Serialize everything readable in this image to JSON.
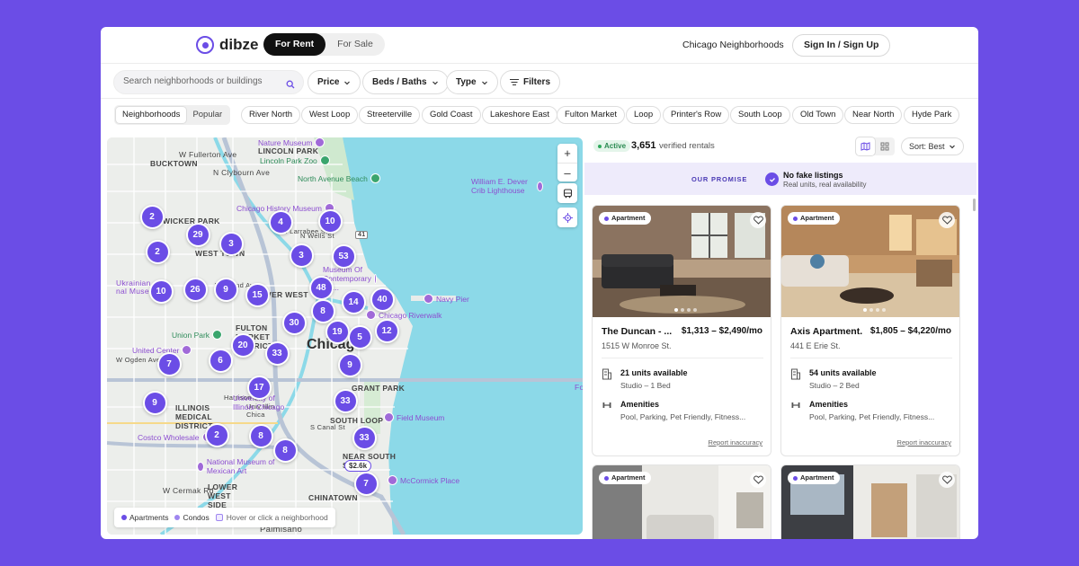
{
  "header": {
    "logo": "dibze",
    "seg": [
      {
        "label": "For Rent",
        "active": true
      },
      {
        "label": "For Sale",
        "active": false
      }
    ],
    "link": "Chicago Neighborhoods",
    "signin": "Sign In / Sign Up"
  },
  "filters": {
    "search_placeholder": "Search neighborhoods or buildings",
    "price": "Price",
    "beds": "Beds / Baths",
    "type": "Type",
    "more": "Filters"
  },
  "chips": {
    "tabs": [
      "Neighborhoods",
      "Popular"
    ],
    "items": [
      "River North",
      "West Loop",
      "Streeterville",
      "Gold Coast",
      "Lakeshore East",
      "Fulton Market",
      "Loop",
      "Printer's Row",
      "South Loop",
      "Old Town",
      "Near North",
      "Hyde Park"
    ]
  },
  "map": {
    "city": "Chicago",
    "labels": [
      "BUCKTOWN",
      "W Fullerton Ave",
      "N Clybourn Ave",
      "LINCOLN PARK",
      "WICKER PARK",
      "WEST TOWN",
      "RIVER WEST",
      "FULTON MARKET DISTRICT",
      "ILLINOIS MEDICAL DISTRICT",
      "LOWER WEST SIDE",
      "CHINATOWN",
      "GRANT PARK",
      "SOUTH LOOP",
      "NEAR SOUTH SIDE",
      "W Cermak Rd",
      "Palmisano",
      "Ukrainian",
      "nal Museum",
      "S Canal St",
      "N Larrabee St",
      "N Wells St",
      "Fo",
      "Univ Illin Chica",
      "Harrison St",
      "W Ogden Ave",
      "W Grand Ave"
    ],
    "pois": [
      "Nature Museum",
      "Lincoln Park Zoo",
      "North Avenue Beach",
      "Chicago History Museum",
      "William E. Dever Crib Lighthouse",
      "Museum Of Contemporary Art...",
      "Navy Pier",
      "Chicago Riverwalk",
      "Union Park",
      "United Center",
      "University of Illinois Chicago",
      "Costco Wholesale",
      "Field Museum",
      "National Museum of Mexican Art",
      "McCormick Place"
    ],
    "clusters": [
      "2",
      "29",
      "3",
      "4",
      "10",
      "2",
      "3",
      "53",
      "10",
      "26",
      "9",
      "15",
      "48",
      "14",
      "40",
      "8",
      "30",
      "19",
      "5",
      "12",
      "20",
      "33",
      "7",
      "6",
      "9",
      "17",
      "33",
      "9",
      "2",
      "8",
      "33",
      "8",
      "7"
    ],
    "price_pin": "$2.6k",
    "legend": {
      "a": "Apartments",
      "b": "Condos",
      "hint": "Hover or click a neighborhood"
    },
    "route_badge": "41"
  },
  "list": {
    "status": "Active",
    "count": "3,651",
    "count_label": "verified rentals",
    "sort": "Sort: Best"
  },
  "promise": {
    "label": "OUR PROMISE",
    "title": "No fake listings",
    "sub": "Real units, real availability"
  },
  "cards": [
    {
      "badge": "Apartment",
      "name": "The Duncan - ...",
      "price": "$1,313 – $2,490/mo",
      "addr": "1515 W Monroe St.",
      "units": "21 units available",
      "units_sub": "Studio – 1 Bed",
      "amen": "Amenities",
      "amen_sub": "Pool, Parking, Pet Friendly, Fitness...",
      "report": "Report inaccuracy"
    },
    {
      "badge": "Apartment",
      "name": "Axis Apartment...",
      "price": "$1,805 – $4,220/mo",
      "addr": "441 E Erie St.",
      "units": "54 units available",
      "units_sub": "Studio – 2 Bed",
      "amen": "Amenities",
      "amen_sub": "Pool, Parking, Pet Friendly, Fitness...",
      "report": "Report inaccuracy"
    },
    {
      "badge": "Apartment"
    },
    {
      "badge": "Apartment"
    }
  ],
  "colors": {
    "brand": "#6b4de6",
    "bg": "#6b4de6",
    "water": "#8cd9e8",
    "poi": "#8c4ed0",
    "active_green": "#2fa85c"
  }
}
